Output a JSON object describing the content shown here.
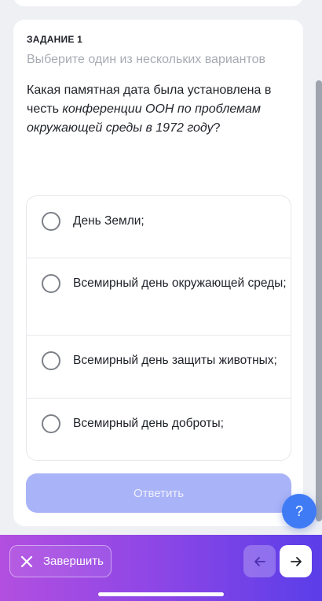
{
  "task": {
    "label": "ЗАДАНИЕ 1",
    "hint": "Выберите один из нескольких вариантов",
    "question_part1": "Какая памятная дата была установлена в честь ",
    "question_italic": "конференции ООН по проблемам окружающей среды в 1972 году",
    "question_end": "?"
  },
  "options": [
    {
      "label": "День Земли;"
    },
    {
      "label": "Всемирный день окружающей среды;"
    },
    {
      "label": "Всемирный день защиты животных;"
    },
    {
      "label": "Всемирный день доброты;"
    }
  ],
  "submit_label": "Ответить",
  "help_label": "?",
  "bottom": {
    "finish_label": "Завершить",
    "prev_icon": "arrow-left-icon",
    "next_icon": "arrow-right-icon"
  },
  "colors": {
    "accent": "#3f7bf5",
    "submit_disabled": "#a9b3f7",
    "bar_gradient_start": "#b24fe0",
    "bar_gradient_end": "#5a3ee8"
  }
}
